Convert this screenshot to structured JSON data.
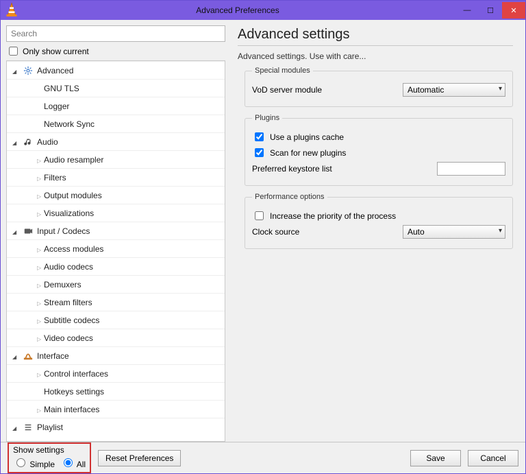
{
  "window": {
    "title": "Advanced Preferences"
  },
  "search": {
    "placeholder": "Search"
  },
  "only_show_current": "Only show current",
  "tree": [
    {
      "level": 0,
      "arrow": "exp",
      "icon": "gear",
      "label": "Advanced"
    },
    {
      "level": 1,
      "arrow": "none",
      "icon": "",
      "label": "GNU TLS"
    },
    {
      "level": 1,
      "arrow": "none",
      "icon": "",
      "label": "Logger"
    },
    {
      "level": 1,
      "arrow": "none",
      "icon": "",
      "label": "Network Sync"
    },
    {
      "level": 0,
      "arrow": "exp",
      "icon": "audio",
      "label": "Audio"
    },
    {
      "level": 1,
      "arrow": "col",
      "icon": "",
      "label": "Audio resampler"
    },
    {
      "level": 1,
      "arrow": "col",
      "icon": "",
      "label": "Filters"
    },
    {
      "level": 1,
      "arrow": "col",
      "icon": "",
      "label": "Output modules"
    },
    {
      "level": 1,
      "arrow": "col",
      "icon": "",
      "label": "Visualizations"
    },
    {
      "level": 0,
      "arrow": "exp",
      "icon": "codec",
      "label": "Input / Codecs"
    },
    {
      "level": 1,
      "arrow": "col",
      "icon": "",
      "label": "Access modules"
    },
    {
      "level": 1,
      "arrow": "col",
      "icon": "",
      "label": "Audio codecs"
    },
    {
      "level": 1,
      "arrow": "col",
      "icon": "",
      "label": "Demuxers"
    },
    {
      "level": 1,
      "arrow": "col",
      "icon": "",
      "label": "Stream filters"
    },
    {
      "level": 1,
      "arrow": "col",
      "icon": "",
      "label": "Subtitle codecs"
    },
    {
      "level": 1,
      "arrow": "col",
      "icon": "",
      "label": "Video codecs"
    },
    {
      "level": 0,
      "arrow": "exp",
      "icon": "if",
      "label": "Interface"
    },
    {
      "level": 1,
      "arrow": "col",
      "icon": "",
      "label": "Control interfaces"
    },
    {
      "level": 1,
      "arrow": "none",
      "icon": "",
      "label": "Hotkeys settings"
    },
    {
      "level": 1,
      "arrow": "col",
      "icon": "",
      "label": "Main interfaces"
    },
    {
      "level": 0,
      "arrow": "exp",
      "icon": "list",
      "label": "Playlist"
    }
  ],
  "right": {
    "title": "Advanced settings",
    "subtitle": "Advanced settings. Use with care...",
    "groups": {
      "special": {
        "legend": "Special modules",
        "vod_label": "VoD server module",
        "vod_value": "Automatic"
      },
      "plugins": {
        "legend": "Plugins",
        "cache": "Use a plugins cache",
        "scan": "Scan for new plugins",
        "keystore": "Preferred keystore list"
      },
      "perf": {
        "legend": "Performance options",
        "priority": "Increase the priority of the process",
        "clock_label": "Clock source",
        "clock_value": "Auto"
      }
    }
  },
  "footer": {
    "show_settings": "Show settings",
    "simple": "Simple",
    "all": "All",
    "reset": "Reset Preferences",
    "save": "Save",
    "cancel": "Cancel"
  }
}
